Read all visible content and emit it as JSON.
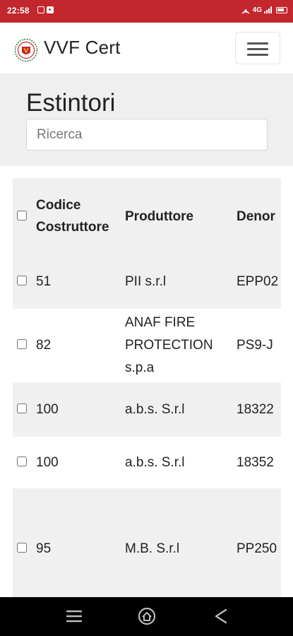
{
  "status_bar": {
    "time": "22:58",
    "network": "4G",
    "icons": [
      "gallery-icon",
      "notification-icon",
      "hotspot-icon",
      "signal-icon",
      "battery-icon"
    ]
  },
  "navbar": {
    "brand": "VVF Cert",
    "logo_icon": "vvf-logo-icon",
    "menu_icon": "hamburger-icon"
  },
  "page": {
    "title": "Estintori",
    "search_placeholder": "Ricerca",
    "search_value": ""
  },
  "table": {
    "headers": [
      "Codice Costruttore",
      "Produttore",
      "Denor"
    ],
    "rows": [
      {
        "codice": "51",
        "produttore": "PII s.r.l",
        "denominazione": "EPP02"
      },
      {
        "codice": "82",
        "produttore": "ANAF FIRE PROTECTION s.p.a",
        "denominazione": "PS9-J"
      },
      {
        "codice": "100",
        "produttore": "a.b.s. S.r.l",
        "denominazione": "18322"
      },
      {
        "codice": "100",
        "produttore": "a.b.s. S.r.l",
        "denominazione": "18352"
      },
      {
        "codice": "95",
        "produttore": "M.B. S.r.l",
        "denominazione": "PP250"
      }
    ]
  },
  "colors": {
    "status_bar": "#c1272d",
    "header_bg": "#efefef",
    "stripe": "#f0f0f0",
    "system_nav": "#000000"
  },
  "system_nav": {
    "icons": [
      "menu-icon",
      "home-icon",
      "back-icon"
    ]
  }
}
